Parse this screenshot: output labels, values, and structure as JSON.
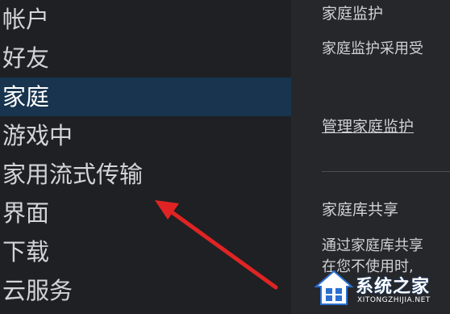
{
  "sidebar": {
    "items": [
      {
        "label": "帐户"
      },
      {
        "label": "好友"
      },
      {
        "label": "家庭",
        "active": true
      },
      {
        "label": "游戏中"
      },
      {
        "label": "家用流式传输"
      },
      {
        "label": "界面"
      },
      {
        "label": "下载"
      },
      {
        "label": "云服务"
      }
    ]
  },
  "content": {
    "family_view_title": "家庭监护",
    "family_view_desc": "家庭监护采用受",
    "manage_link": "管理家庭监护",
    "library_sharing_title": "家庭库共享",
    "library_sharing_desc_line1": "通过家庭库共享",
    "library_sharing_desc_line2": "在您不使用时,"
  },
  "watermark": {
    "text": "系统之家",
    "url": "XITONGZHIJIA.NET"
  },
  "colors": {
    "active_bg": "#18344e",
    "arrow": "#e02424"
  }
}
